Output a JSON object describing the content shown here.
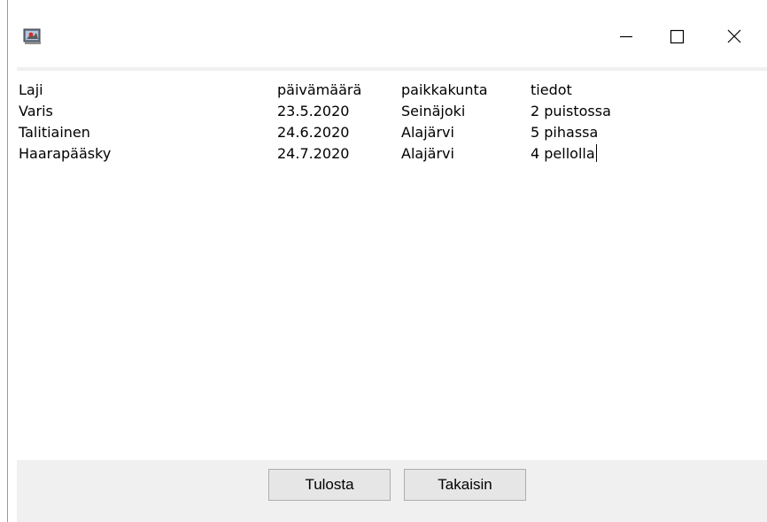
{
  "window": {
    "title": "",
    "controls": {
      "minimize_icon": "minimize-icon",
      "maximize_icon": "maximize-icon",
      "close_icon": "close-icon"
    }
  },
  "table": {
    "headers": [
      "Laji",
      "päivämäärä",
      "paikkakunta",
      "tiedot"
    ],
    "rows": [
      [
        "Varis",
        "23.5.2020",
        "Seinäjoki",
        "2 puistossa"
      ],
      [
        "Talitiainen",
        "24.6.2020",
        "Alajärvi",
        "5 pihassa"
      ],
      [
        "Haarapääsky",
        "24.7.2020",
        "Alajärvi",
        "4 pellolla"
      ]
    ]
  },
  "buttons": {
    "print_label": "Tulosta",
    "back_label": "Takaisin"
  },
  "colors": {
    "panel_background": "#f0f0f0",
    "button_background": "#e6e6e6",
    "button_border": "#adadad"
  }
}
